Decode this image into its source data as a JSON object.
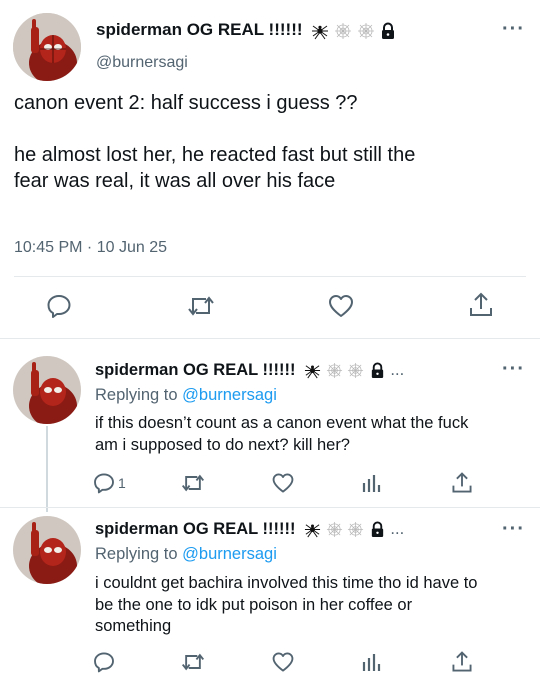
{
  "main_tweet": {
    "display_name": "spiderman OG REAL !!!!!!",
    "handle": "@burnersagi",
    "text_line1": "canon event 2: half success i guess ??",
    "text_line2": "he almost lost her, he reacted fast but still the",
    "text_line3": "fear was real, it was all over his face",
    "time": "10:45 PM · 10 Jun 25"
  },
  "replies": [
    {
      "display_name": "spiderman OG REAL !!!!!!",
      "ellipsis": "...",
      "replying_prefix": "Replying to",
      "replying_to": "@burnersagi",
      "text_line1": "if this doesn’t count as a canon event what the fuck",
      "text_line2": "am i supposed to do next? kill her?",
      "reply_count": "1"
    },
    {
      "display_name": "spiderman OG REAL !!!!!!",
      "ellipsis": "...",
      "replying_prefix": "Replying to",
      "replying_to": "@burnersagi",
      "text_line1": "i couldnt get bachira involved this time tho id have to",
      "text_line2": "be the one to idk put poison in her coffee or",
      "text_line3": "something"
    }
  ],
  "colors": {
    "text": "#0f1419",
    "secondary": "#536471",
    "link": "#1d9bf0",
    "divider": "#e6e9ec"
  }
}
